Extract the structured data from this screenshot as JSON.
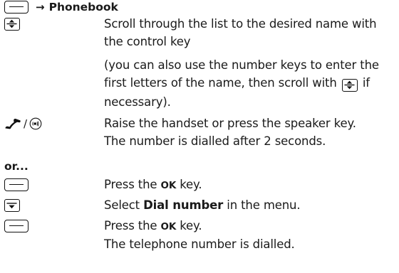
{
  "header": {
    "arrow": "→",
    "title": "Phonebook"
  },
  "steps": [
    {
      "icon": "control-key-up-down-icon",
      "text": "Scroll through the list to the desired name with the control key"
    },
    {
      "icon": "",
      "text_before": "(you can also use the number keys to enter the first letters of the name, then scroll with",
      "inline_icon": "control-key-up-down-icon",
      "text_after": "if necessary)."
    },
    {
      "icon": "handset-icon",
      "icon_separator": "/",
      "icon2": "speaker-key-icon",
      "text_line1": "Raise the handset or press the speaker key.",
      "text_line2": "The number is dialled after 2 seconds."
    }
  ],
  "or_label": "or...",
  "alt_steps": [
    {
      "icon": "soft-key-icon",
      "text_before": "Press the ",
      "key": "OK",
      "text_after": " key."
    },
    {
      "icon": "control-key-down-icon",
      "text_before": "Select ",
      "bold": "Dial number",
      "text_after": " in the menu."
    },
    {
      "icon": "soft-key-icon",
      "text_before": "Press the ",
      "key": "OK",
      "text_after": " key.",
      "text_line2": "The telephone number is dialled."
    }
  ]
}
